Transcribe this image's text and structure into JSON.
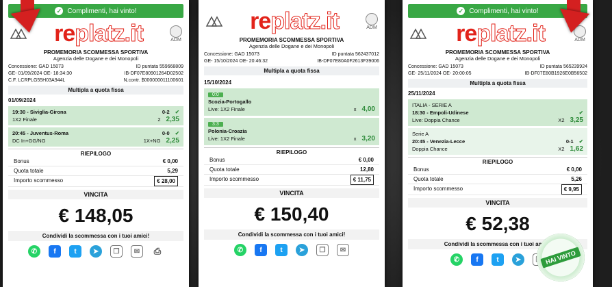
{
  "common": {
    "banner": "Complimenti, hai vinto!",
    "brand_re": "re",
    "brand_rest": "platz.it",
    "adm": "ADM",
    "promo_title": "PROMEMORIA SCOMMESSA SPORTIVA",
    "promo_sub": "Agenzia delle Dogane e dei Monopoli",
    "riepilogo": "RIEPILOGO",
    "bonus_label": "Bonus",
    "quota_label": "Quota totale",
    "importo_label": "Importo scommesso",
    "vincita_label": "VINCITA",
    "share_text": "Condividi la scommessa con i tuoi amici!"
  },
  "card1": {
    "concessione": "Concessione: GAD 15073",
    "id_puntata": "ID puntata 559668809",
    "ge_line": "GE- 01/09/2024 OE- 18:34:30",
    "ib_line": "IB-DF07E80901264D02502",
    "cf_line": "C.F. LCRPLG55H03A944L",
    "ncontr": "N.contr. $000000011100601",
    "bet_type": "Multipla a quota fissa",
    "date": "01/09/2024",
    "events": [
      {
        "line1_left": "19:30 - Siviglia-Girona",
        "line1_score": "0-2",
        "line2_left": "1X2 Finale",
        "line2_pick": "2",
        "odds": "2,35"
      },
      {
        "line1_left": "20:45 - Juventus-Roma",
        "line1_score": "0-0",
        "line2_left": "DC In+GG/NG",
        "line2_pick": "1X+NG",
        "odds": "2,25"
      }
    ],
    "bonus": "€ 0,00",
    "quota": "5,29",
    "importo": "€ 28,00",
    "vincita": "€ 148,05"
  },
  "card2": {
    "concessione": "Concessione: GAD 15073",
    "id_puntata": "ID puntata 562437012",
    "ge_line": "GE- 15/10/2024 OE- 20:46:32",
    "ib_line": "IB-DF07E80A0F2613F39006",
    "bet_type": "Multipla a quota fissa",
    "date": "15/10/2024",
    "events": [
      {
        "score": "0:0",
        "match": "Scozia-Portogallo",
        "market": "Live: 1X2 Finale",
        "pick": "x",
        "odds": "4,00"
      },
      {
        "score": "3:3",
        "match": "Polonia-Croazia",
        "market": "Live: 1X2 Finale",
        "pick": "x",
        "odds": "3,20"
      }
    ],
    "bonus": "€ 0,00",
    "quota": "12,80",
    "importo": "€ 11,75",
    "vincita": "€ 150,40"
  },
  "card3": {
    "concessione": "Concessione: GAD 15073",
    "id_puntata": "ID puntata 565239924",
    "ge_line": "GE- 25/11/2024 OE- 20:00:05",
    "ib_line": "IB-DF07E80B1926E0B56502",
    "bet_type": "Multipla a quota fissa",
    "date": "25/11/2024",
    "events": [
      {
        "league": "ITALIA - SERIE A",
        "line1_left": "18:30 - Empoli-Udinese",
        "line1_score": "",
        "line2_left": "Live: Doppia Chance",
        "pick": "X2",
        "odds": "3,25"
      },
      {
        "league": "Serie A",
        "line1_left": "20:45 - Venezia-Lecce",
        "line1_score": "0-1",
        "line2_left": "Doppia Chance",
        "pick": "X2",
        "odds": "1,62"
      }
    ],
    "bonus": "€ 0,00",
    "quota": "5,26",
    "importo": "€ 9,95",
    "vincita": "€ 52,38",
    "stamp": "HAI VINTO"
  },
  "colors": {
    "win_green": "#39a845",
    "brand_red": "#e2231a",
    "arrow_red": "#d42020",
    "event_green": "#cfe9d1"
  },
  "share_icons": [
    "whatsapp-icon",
    "facebook-icon",
    "twitter-icon",
    "telegram-icon",
    "copy-icon",
    "mail-icon",
    "print-icon"
  ]
}
